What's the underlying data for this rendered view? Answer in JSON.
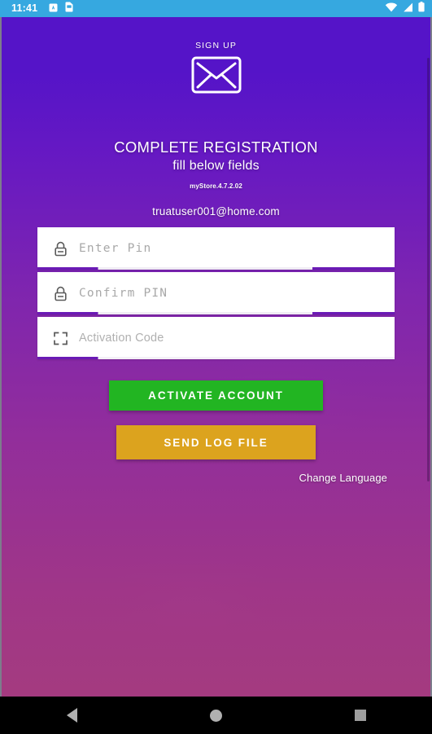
{
  "status_bar": {
    "time": "11:41",
    "left_icons": [
      "app-notification-icon",
      "sim-card-icon"
    ],
    "right_icons": [
      "wifi-icon",
      "cellular-signal-icon",
      "battery-icon"
    ],
    "background_color": "#36a8e0"
  },
  "header": {
    "signup_label": "SIGN UP",
    "brand_icon": "envelope-icon"
  },
  "titles": {
    "main": "COMPLETE REGISTRATION",
    "sub": "fill below fields",
    "version": "myStore.4.7.2.02",
    "email": "truatuser001@home.com"
  },
  "form": {
    "fields": [
      {
        "name": "pin",
        "placeholder": "Enter Pin",
        "value": "",
        "icon": "lock-icon",
        "font": "mono"
      },
      {
        "name": "confirm_pin",
        "placeholder": "Confirm PIN",
        "value": "",
        "icon": "lock-icon",
        "font": "mono"
      },
      {
        "name": "activation_code",
        "placeholder": "Activation Code",
        "value": "",
        "icon": "scan-code-icon",
        "font": "sans"
      }
    ]
  },
  "buttons": {
    "activate": {
      "label": "ACTIVATE ACCOUNT",
      "color": "#22b522"
    },
    "send_log": {
      "label": "SEND LOG FILE",
      "color": "#dca31e"
    }
  },
  "links": {
    "change_language": "Change Language"
  },
  "nav_bar": {
    "back": "back-button",
    "home": "home-button",
    "recents": "recents-button"
  },
  "theme": {
    "gradient_top": "#5514c8",
    "gradient_bottom": "#a43a85",
    "field_underline": "#6a1ab5"
  }
}
